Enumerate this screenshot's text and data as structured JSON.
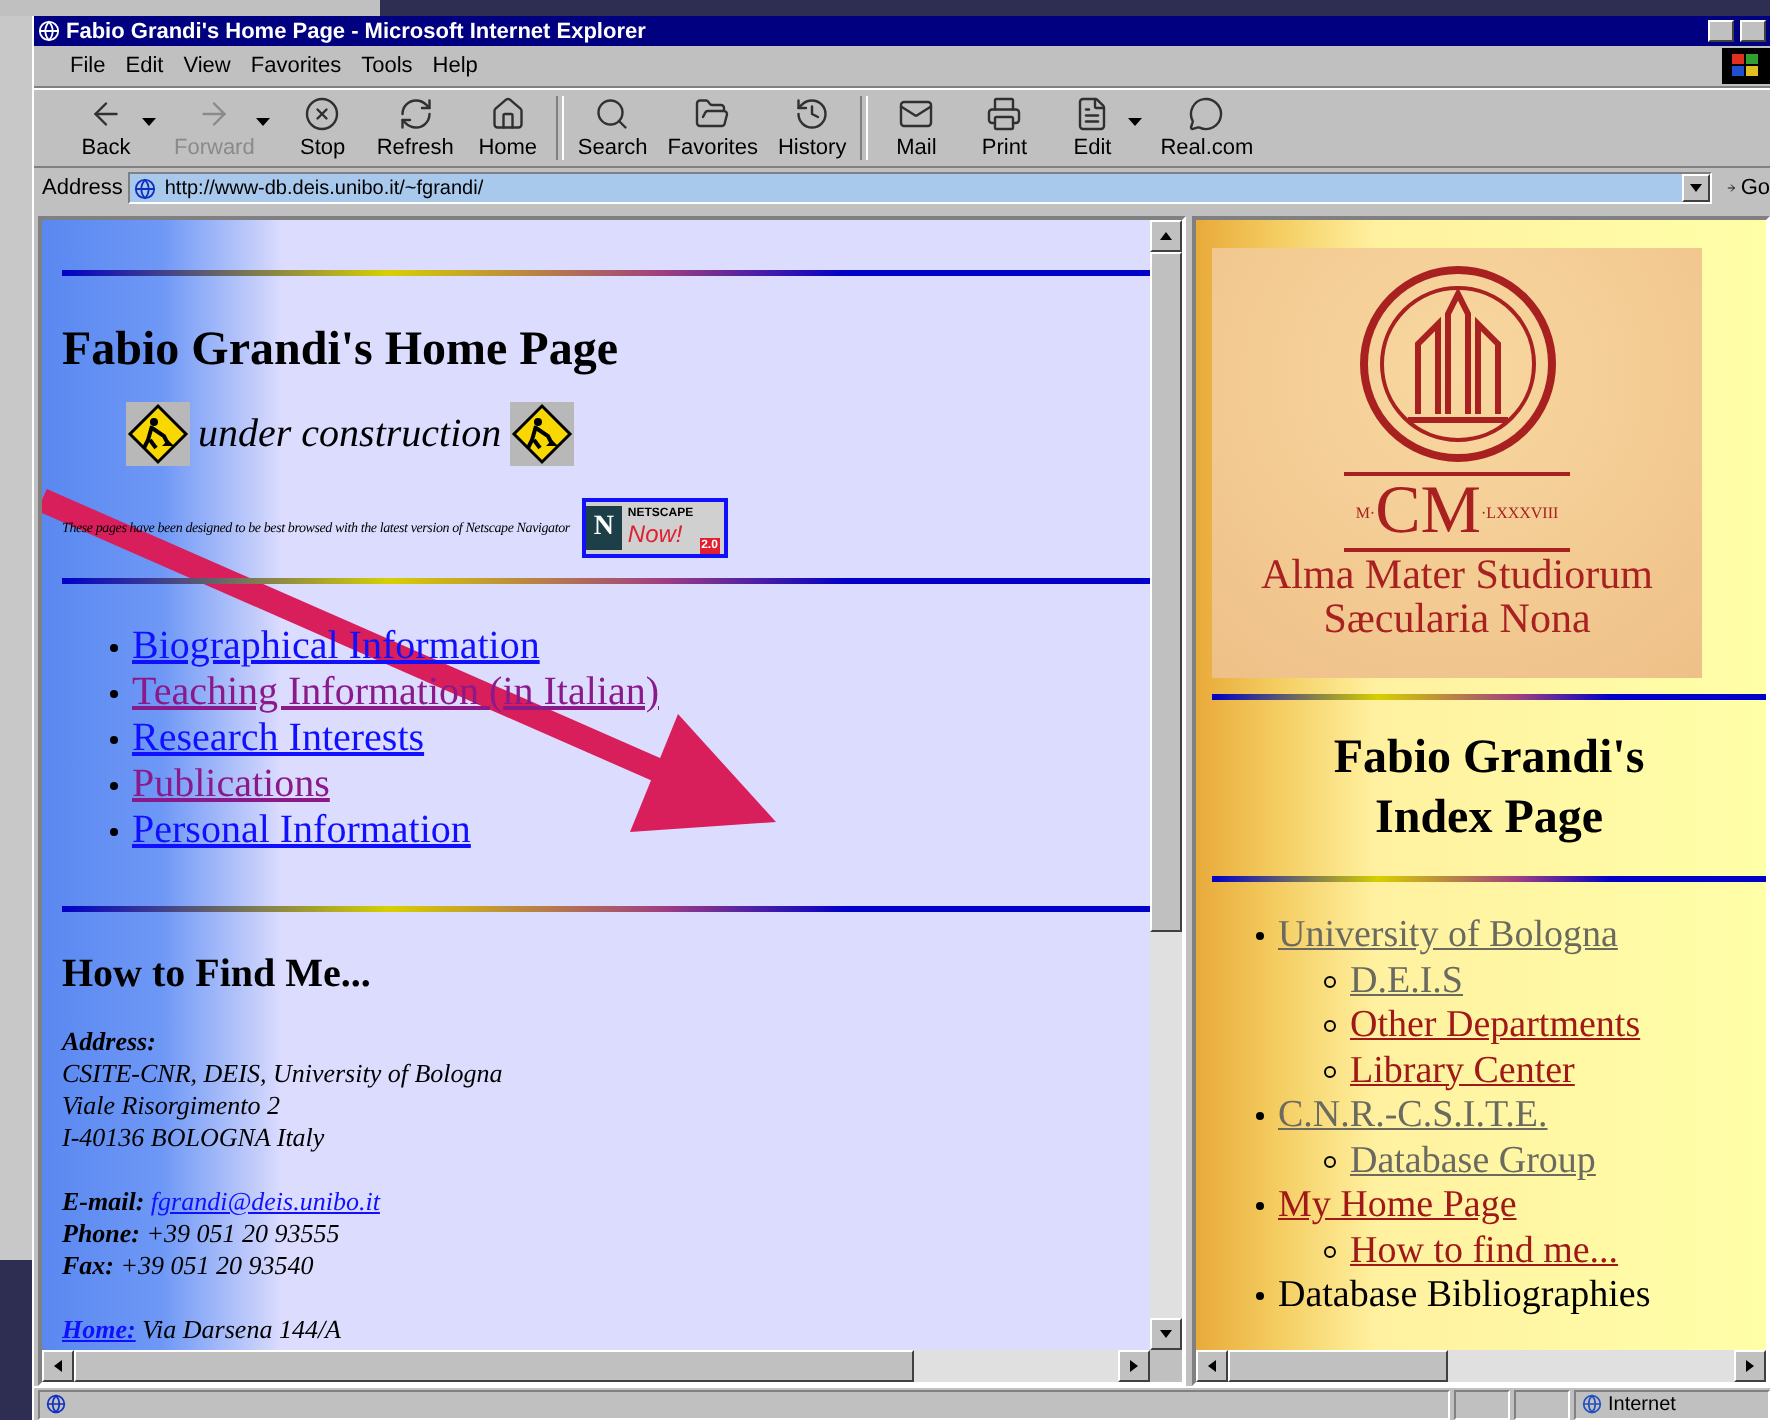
{
  "window": {
    "title": "Fabio Grandi's Home Page - Microsoft Internet Explorer"
  },
  "menu": [
    "File",
    "Edit",
    "View",
    "Favorites",
    "Tools",
    "Help"
  ],
  "toolbar": [
    {
      "kind": "back",
      "label": "Back",
      "disabled": false,
      "dropdown": true
    },
    {
      "kind": "forward",
      "label": "Forward",
      "disabled": true,
      "dropdown": true
    },
    {
      "kind": "stop",
      "label": "Stop",
      "disabled": false,
      "dropdown": false
    },
    {
      "kind": "refresh",
      "label": "Refresh",
      "disabled": false,
      "dropdown": false
    },
    {
      "kind": "home",
      "label": "Home",
      "disabled": false,
      "dropdown": false
    },
    {
      "kind": "search",
      "label": "Search",
      "disabled": false,
      "dropdown": false,
      "group_start": true
    },
    {
      "kind": "favorites",
      "label": "Favorites",
      "disabled": false,
      "dropdown": false
    },
    {
      "kind": "history",
      "label": "History",
      "disabled": false,
      "dropdown": false
    },
    {
      "kind": "mail",
      "label": "Mail",
      "disabled": false,
      "dropdown": false,
      "group_start": true
    },
    {
      "kind": "print",
      "label": "Print",
      "disabled": false,
      "dropdown": false
    },
    {
      "kind": "edit",
      "label": "Edit",
      "disabled": false,
      "dropdown": true
    },
    {
      "kind": "real",
      "label": "Real.com",
      "disabled": false,
      "dropdown": false
    }
  ],
  "address": {
    "label": "Address",
    "value": "http://www-db.deis.unibo.it/~fgrandi/",
    "go": "Go"
  },
  "left_frame": {
    "title": "Fabio Grandi's Home Page",
    "construction": "under construction",
    "browser_note": "These pages have been designed to be best browsed with the latest version of Netscape Navigator",
    "badge": {
      "letter": "N",
      "brand": "NETSCAPE",
      "now": "Now!",
      "version": "2.0"
    },
    "links": [
      {
        "text": "Biographical Information",
        "visited": false
      },
      {
        "text": "Teaching Information (in Italian)",
        "visited": true
      },
      {
        "text": "Research Interests",
        "visited": false
      },
      {
        "text": "Publications",
        "visited": true
      },
      {
        "text": "Personal Information",
        "visited": false
      }
    ],
    "find_heading": "How to Find Me...",
    "address_label": "Address:",
    "address_lines": [
      "CSITE-CNR, DEIS, University of Bologna",
      "Viale Risorgimento 2",
      "I-40136 BOLOGNA Italy"
    ],
    "contacts": [
      {
        "label": "E-mail:",
        "value": "fgrandi@deis.unibo.it",
        "kind": "email"
      },
      {
        "label": "Phone:",
        "value": "+39 051 20 93555",
        "kind": "text"
      },
      {
        "label": "Fax:",
        "value": "+39 051 20 93540",
        "kind": "text"
      }
    ],
    "home": {
      "label": "Home:",
      "value": "Via Darsena 144/A"
    }
  },
  "right_frame": {
    "logo": {
      "year_left": "M·",
      "year_main": "CM",
      "year_right": "·LXXXVIII",
      "line1": "Alma Mater Studiorum",
      "line2": "Sæcularia Nona"
    },
    "title": "Fabio Grandi's Index Page",
    "items": [
      {
        "text": "University of Bologna",
        "kind": "link",
        "visited": true,
        "children": [
          {
            "text": "D.E.I.S",
            "kind": "link",
            "visited": true
          },
          {
            "text": "Other Departments",
            "kind": "link",
            "visited": false
          },
          {
            "text": "Library Center",
            "kind": "link",
            "visited": false
          }
        ]
      },
      {
        "text": "C.N.R.-C.S.I.T.E.",
        "kind": "link",
        "visited": true,
        "children": [
          {
            "text": "Database Group",
            "kind": "link",
            "visited": true
          }
        ]
      },
      {
        "text": "My Home Page",
        "kind": "link",
        "visited": false,
        "children": [
          {
            "text": "How to find me...",
            "kind": "link",
            "visited": false
          }
        ]
      },
      {
        "text": "Database Bibliographies",
        "kind": "text"
      }
    ]
  },
  "status_bar": {
    "zone": "Internet"
  }
}
